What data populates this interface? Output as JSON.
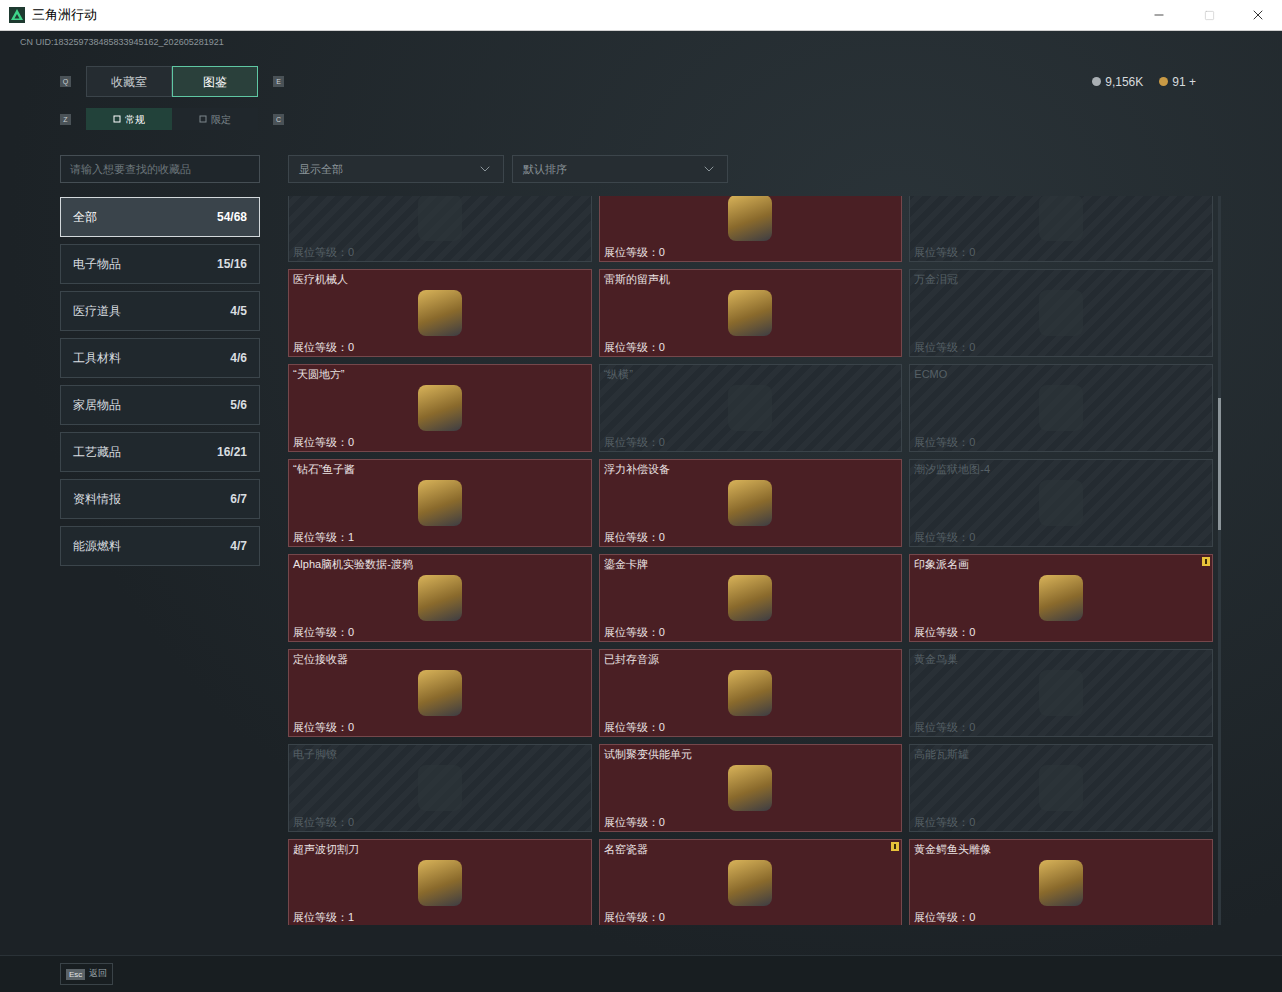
{
  "window": {
    "title": "三角洲行动"
  },
  "uid": "CN UID:183259738485833945162_202605281921",
  "currency": [
    {
      "amount": "9,156K",
      "kind": "silver"
    },
    {
      "amount": "91 +",
      "kind": "gold"
    }
  ],
  "main_tabs": {
    "prev_key": "Q",
    "next_key": "E",
    "items": [
      {
        "label": "收藏室",
        "selected": false
      },
      {
        "label": "图鉴",
        "selected": true
      }
    ]
  },
  "sub_tabs": {
    "prev_key": "Z",
    "next_key": "C",
    "items": [
      {
        "label": "常规",
        "selected": true
      },
      {
        "label": "限定",
        "selected": false
      }
    ]
  },
  "search": {
    "placeholder": "请输入想要查找的收藏品"
  },
  "filters": [
    {
      "value": "显示全部"
    },
    {
      "value": "默认排序"
    }
  ],
  "categories": [
    {
      "label": "全部",
      "count": "54/68",
      "selected": true
    },
    {
      "label": "电子物品",
      "count": "15/16",
      "selected": false
    },
    {
      "label": "医疗道具",
      "count": "4/5",
      "selected": false
    },
    {
      "label": "工具材料",
      "count": "4/6",
      "selected": false
    },
    {
      "label": "家居物品",
      "count": "5/6",
      "selected": false
    },
    {
      "label": "工艺藏品",
      "count": "16/21",
      "selected": false
    },
    {
      "label": "资料情报",
      "count": "6/7",
      "selected": false
    },
    {
      "label": "能源燃料",
      "count": "4/7",
      "selected": false
    }
  ],
  "items": [
    {
      "name": "",
      "owned": false,
      "level_text": "展位等级：0",
      "new": false
    },
    {
      "name": "",
      "owned": true,
      "level_text": "展位等级：0",
      "new": false
    },
    {
      "name": "",
      "owned": false,
      "level_text": "展位等级：0",
      "new": false
    },
    {
      "name": "医疗机械人",
      "owned": true,
      "level_text": "展位等级：0",
      "new": false
    },
    {
      "name": "雷斯的留声机",
      "owned": true,
      "level_text": "展位等级：0",
      "new": false
    },
    {
      "name": "万金泪冠",
      "owned": false,
      "level_text": "展位等级：0",
      "new": false
    },
    {
      "name": "“天圆地方”",
      "owned": true,
      "level_text": "展位等级：0",
      "new": false
    },
    {
      "name": "“纵横”",
      "owned": false,
      "level_text": "展位等级：0",
      "new": false
    },
    {
      "name": "ECMO",
      "owned": false,
      "level_text": "展位等级：0",
      "new": false
    },
    {
      "name": "“钻石”鱼子酱",
      "owned": true,
      "level_text": "展位等级：1",
      "new": false
    },
    {
      "name": "浮力补偿设备",
      "owned": true,
      "level_text": "展位等级：0",
      "new": false
    },
    {
      "name": "潮汐监狱地图-4",
      "owned": false,
      "level_text": "展位等级：0",
      "new": false
    },
    {
      "name": "Alpha脑机实验数据-渡鸦",
      "owned": true,
      "level_text": "展位等级：0",
      "new": false
    },
    {
      "name": "鎏金卡牌",
      "owned": true,
      "level_text": "展位等级：0",
      "new": false
    },
    {
      "name": "印象派名画",
      "owned": true,
      "level_text": "展位等级：0",
      "new": true
    },
    {
      "name": "定位接收器",
      "owned": true,
      "level_text": "展位等级：0",
      "new": false
    },
    {
      "name": "已封存音源",
      "owned": true,
      "level_text": "展位等级：0",
      "new": false
    },
    {
      "name": "黄金鸟巢",
      "owned": false,
      "level_text": "展位等级：0",
      "new": false
    },
    {
      "name": "电子脚镣",
      "owned": false,
      "level_text": "展位等级：0",
      "new": false
    },
    {
      "name": "试制聚变供能单元",
      "owned": true,
      "level_text": "展位等级：0",
      "new": false
    },
    {
      "name": "高能瓦斯罐",
      "owned": false,
      "level_text": "展位等级：0",
      "new": false
    },
    {
      "name": "超声波切割刀",
      "owned": true,
      "level_text": "展位等级：1",
      "new": false
    },
    {
      "name": "名窑瓷器",
      "owned": true,
      "level_text": "展位等级：0",
      "new": true
    },
    {
      "name": "黄金鳄鱼头雕像",
      "owned": true,
      "level_text": "展位等级：0",
      "new": false
    }
  ],
  "scrollbar": {
    "level": 0.277,
    "thumb": 0.181
  },
  "footer": {
    "key": "Esc",
    "label": "返回"
  }
}
